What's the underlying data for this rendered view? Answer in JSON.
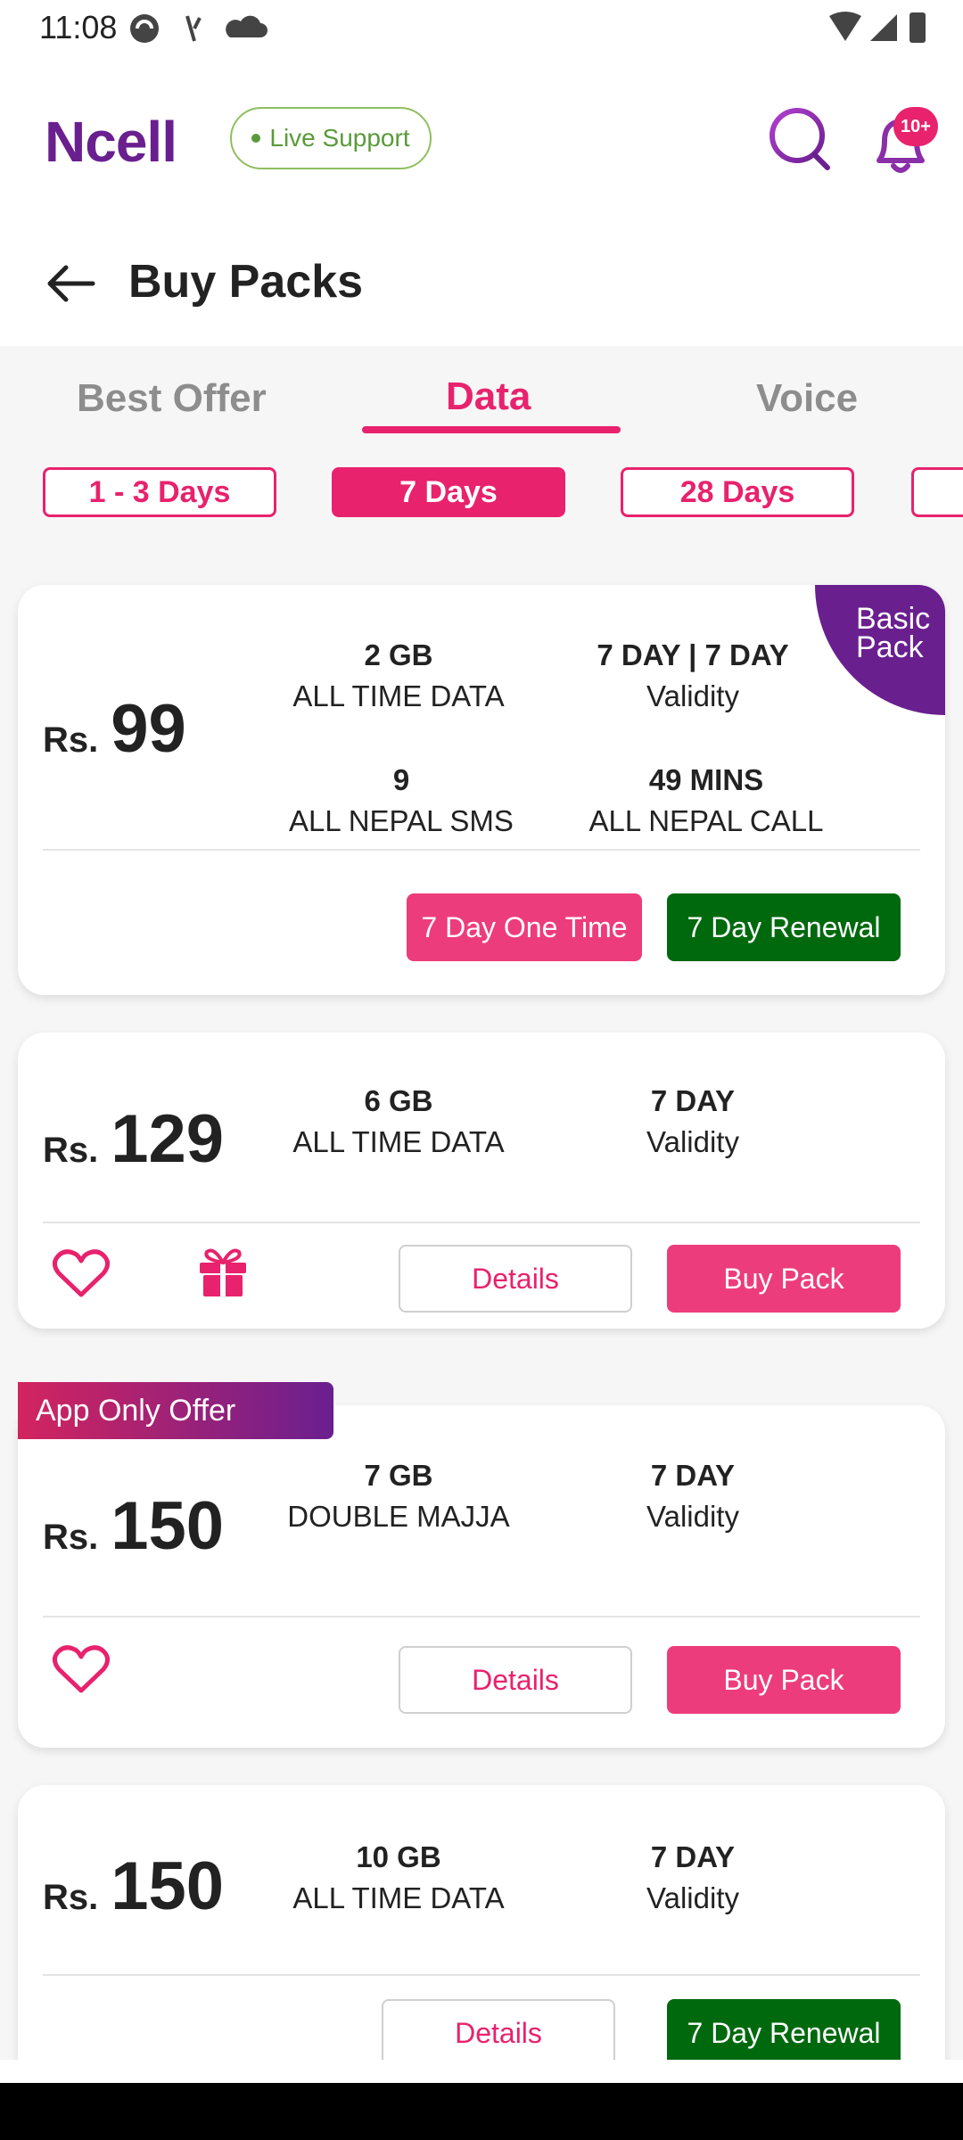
{
  "status": {
    "time": "11:08"
  },
  "header": {
    "logo": "Ncell",
    "live_support": "Live Support",
    "notifications_badge": "10+"
  },
  "title": "Buy Packs",
  "tabs": [
    {
      "label": "Best Offer",
      "active": false
    },
    {
      "label": "Data",
      "active": true
    },
    {
      "label": "Voice",
      "active": false
    }
  ],
  "filters": [
    {
      "label": "1 - 3 Days",
      "active": false
    },
    {
      "label": "7 Days",
      "active": true
    },
    {
      "label": "28 Days",
      "active": false
    }
  ],
  "packs": [
    {
      "currency": "Rs.",
      "price": "99",
      "corner_badge": "Basic Pack",
      "specs": [
        {
          "value": "2 GB",
          "label": "ALL TIME DATA"
        },
        {
          "value": "7 DAY | 7 DAY",
          "label": "Validity"
        },
        {
          "value": "9",
          "label": "ALL NEPAL SMS"
        },
        {
          "value": "49 MINS",
          "label": "ALL NEPAL CALL"
        }
      ],
      "buttons": [
        "7 Day One Time",
        "7 Day Renewal"
      ]
    },
    {
      "currency": "Rs.",
      "price": "129",
      "specs": [
        {
          "value": "6 GB",
          "label": "ALL TIME DATA"
        },
        {
          "value": "7 DAY",
          "label": "Validity"
        }
      ],
      "buttons": [
        "Details",
        "Buy Pack"
      ]
    },
    {
      "currency": "Rs.",
      "price": "150",
      "ribbon": "App Only Offer",
      "specs": [
        {
          "value": "7 GB",
          "label": "DOUBLE MAJJA"
        },
        {
          "value": "7 DAY",
          "label": "Validity"
        }
      ],
      "buttons": [
        "Details",
        "Buy Pack"
      ]
    },
    {
      "currency": "Rs.",
      "price": "150",
      "specs": [
        {
          "value": "10 GB",
          "label": "ALL TIME DATA"
        },
        {
          "value": "7 DAY",
          "label": "Validity"
        }
      ],
      "buttons": [
        "Details",
        "7 Day Renewal"
      ]
    }
  ],
  "colors": {
    "brand_purple": "#6a1f8f",
    "accent_pink": "#e8226d",
    "renewal_green": "#00690e"
  }
}
